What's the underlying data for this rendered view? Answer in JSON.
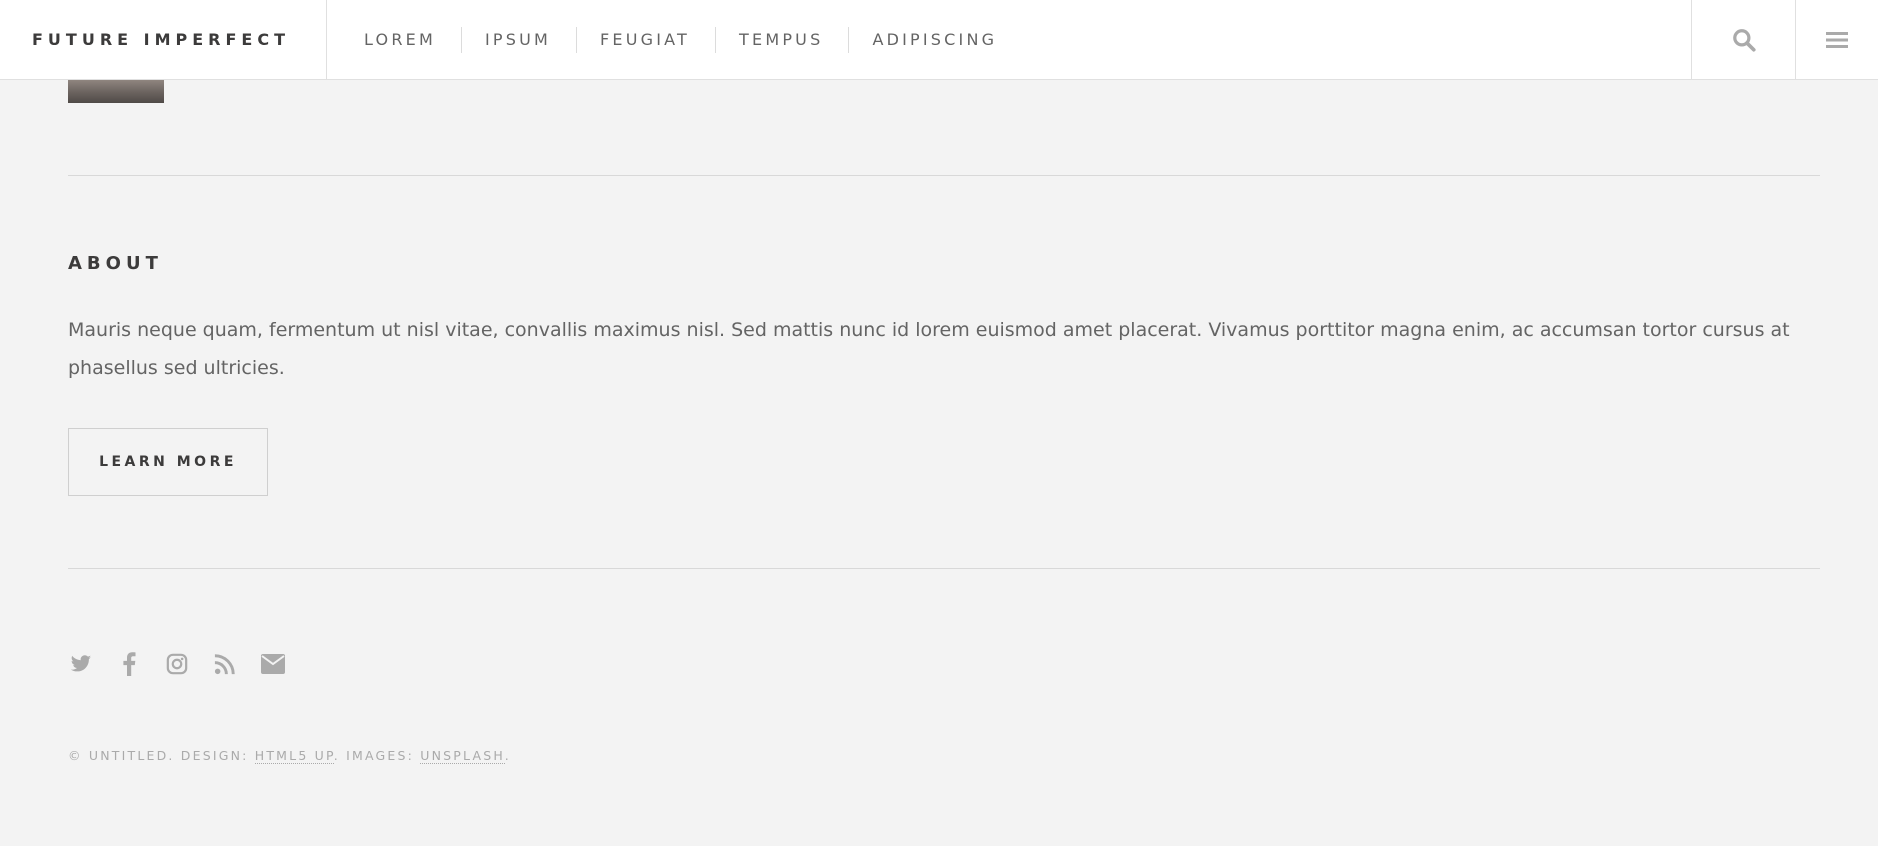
{
  "header": {
    "brand": "FUTURE IMPERFECT",
    "nav": [
      "LOREM",
      "IPSUM",
      "FEUGIAT",
      "TEMPUS",
      "ADIPISCING"
    ],
    "search_icon": "search-icon",
    "menu_icon": "hamburger-menu-icon"
  },
  "about": {
    "title": "ABOUT",
    "text": "Mauris neque quam, fermentum ut nisl vitae, convallis maximus nisl. Sed mattis nunc id lorem euismod amet placerat. Vivamus porttitor magna enim, ac accumsan tortor cursus at phasellus sed ultricies.",
    "button_label": "LEARN MORE"
  },
  "footer": {
    "social_icons": [
      "twitter-icon",
      "facebook-icon",
      "instagram-icon",
      "rss-icon",
      "email-icon"
    ],
    "copyright_prefix": "© UNTITLED. DESIGN: ",
    "design_link": "HTML5 UP",
    "images_prefix": ". IMAGES: ",
    "images_link": "UNSPLASH",
    "copyright_suffix": "."
  },
  "colors": {
    "background": "#f3f3f3",
    "header_bg": "#ffffff",
    "heading": "#3c3b3b",
    "body_text": "#646464",
    "icon": "#aaaaaa",
    "divider": "#d8d8d8"
  }
}
